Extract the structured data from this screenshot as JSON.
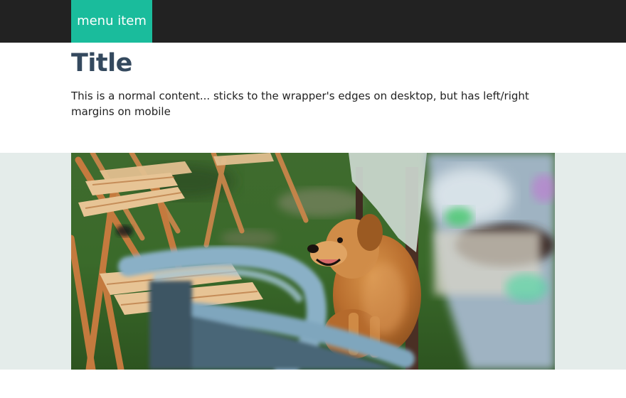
{
  "nav": {
    "menu_item_label": "menu item"
  },
  "main": {
    "title": "Title",
    "content": "This is a normal content... sticks to the wrapper's edges on desktop, but has left/right margins on mobile"
  },
  "colors": {
    "nav_background": "#222222",
    "menu_item_background": "#1abc9c",
    "title_color": "#34495e",
    "band_background": "#e4ecea"
  }
}
